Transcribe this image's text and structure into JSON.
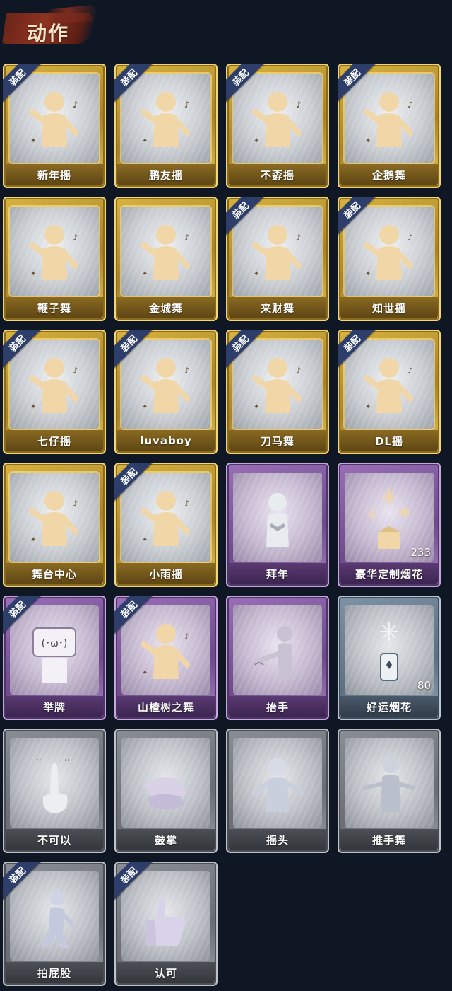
{
  "header": {
    "title": "动作"
  },
  "equip_label": "装配",
  "cards": [
    {
      "label": "新年摇",
      "tier": "gold",
      "equipped": true,
      "icon": "dancer-figure-icon"
    },
    {
      "label": "鹏友摇",
      "tier": "gold",
      "equipped": true,
      "icon": "dancer-figure-icon"
    },
    {
      "label": "不孬摇",
      "tier": "gold",
      "equipped": true,
      "icon": "dancer-figure-icon"
    },
    {
      "label": "企鹅舞",
      "tier": "gold",
      "equipped": true,
      "icon": "dancer-figure-icon"
    },
    {
      "label": "鞭子舞",
      "tier": "gold",
      "equipped": false,
      "icon": "dancer-figure-icon"
    },
    {
      "label": "金城舞",
      "tier": "gold",
      "equipped": false,
      "icon": "dancer-figure-icon"
    },
    {
      "label": "来财舞",
      "tier": "gold",
      "equipped": true,
      "icon": "dancer-figure-icon"
    },
    {
      "label": "知世摇",
      "tier": "gold",
      "equipped": true,
      "icon": "dancer-figure-icon"
    },
    {
      "label": "七仔摇",
      "tier": "gold",
      "equipped": true,
      "icon": "dancer-figure-icon"
    },
    {
      "label": "luvaboy",
      "tier": "gold",
      "equipped": true,
      "icon": "dancer-figure-icon"
    },
    {
      "label": "刀马舞",
      "tier": "gold",
      "equipped": true,
      "icon": "dancer-figure-icon"
    },
    {
      "label": "DL摇",
      "tier": "gold",
      "equipped": true,
      "icon": "dancer-figure-icon"
    },
    {
      "label": "舞台中心",
      "tier": "gold",
      "equipped": false,
      "icon": "dancer-figure-icon"
    },
    {
      "label": "小雨摇",
      "tier": "gold",
      "equipped": true,
      "icon": "dancer-figure-icon"
    },
    {
      "label": "拜年",
      "tier": "purple",
      "equipped": false,
      "icon": "bow-figure-icon"
    },
    {
      "label": "豪华定制烟花",
      "tier": "purple",
      "equipped": false,
      "icon": "fireworks-box-icon",
      "count": "233"
    },
    {
      "label": "举牌",
      "tier": "purple",
      "equipped": true,
      "icon": "hold-sign-figure-icon"
    },
    {
      "label": "山楂树之舞",
      "tier": "purple",
      "equipped": true,
      "icon": "dancer-figure-icon"
    },
    {
      "label": "抬手",
      "tier": "purple",
      "equipped": false,
      "icon": "raise-hand-figure-icon"
    },
    {
      "label": "好运烟花",
      "tier": "blue",
      "equipped": false,
      "icon": "firework-can-icon",
      "count": "80"
    },
    {
      "label": "不可以",
      "tier": "gray",
      "equipped": false,
      "icon": "finger-wag-icon"
    },
    {
      "label": "鼓掌",
      "tier": "gray",
      "equipped": false,
      "icon": "clapping-hands-icon"
    },
    {
      "label": "摇头",
      "tier": "gray",
      "equipped": false,
      "icon": "head-shake-figure-icon"
    },
    {
      "label": "推手舞",
      "tier": "gray",
      "equipped": false,
      "icon": "push-hands-figure-icon"
    },
    {
      "label": "拍屁股",
      "tier": "gray",
      "equipped": true,
      "icon": "slap-figure-icon"
    },
    {
      "label": "认可",
      "tier": "gray",
      "equipped": true,
      "icon": "thumbs-up-icon"
    }
  ]
}
